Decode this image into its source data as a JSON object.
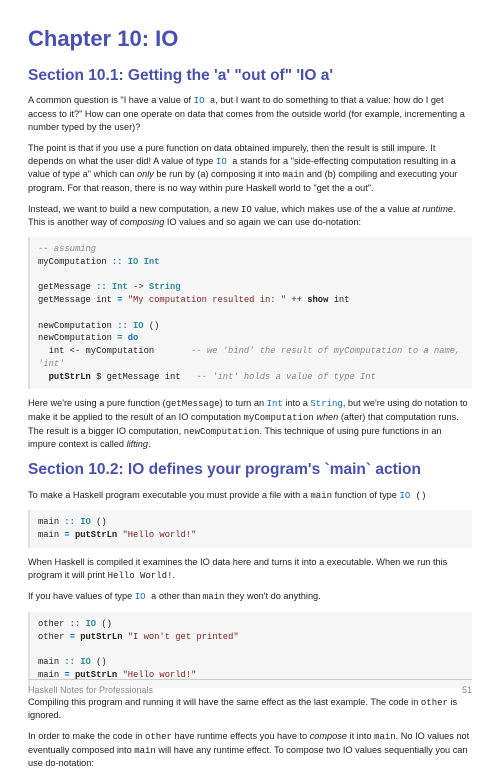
{
  "chapter": {
    "title": "Chapter 10: IO"
  },
  "section1": {
    "title": "Section 10.1: Getting the 'a' \"out of\" 'IO a'",
    "p1_a": "A common question is \"I have a value of ",
    "p1_b": ", but I want to do something to that a value: how do I get access to it?\" How can one operate on data that comes from the outside world (for example, incrementing a number typed by the user)?",
    "p2_a": "The point is that if you use a pure function on data obtained impurely, then the result is still impure. It depends on what the user did! A value of type ",
    "p2_b": " stands for a \"side-effecting computation resulting in a value of type a\" which can ",
    "p2_only": "only",
    "p2_c": " be run by (a) composing it into ",
    "p2_main": "main",
    "p2_d": " and (b) compiling and executing your program. For that reason, there is no way within pure Haskell world to \"get the a out\".",
    "p3_a": "Instead, we want to build a new computation, a new ",
    "p3_io": "IO",
    "p3_b": " value, which makes use of the a value ",
    "p3_runtime": "at runtime",
    "p3_c": ". This is another way of ",
    "p3_composing": "composing",
    "p3_d": " IO values and so again we can use do-notation:",
    "p4_a": "Here we're using a pure function (",
    "p4_gm": "getMessage",
    "p4_b": ") to turn an ",
    "p4_int": "Int",
    "p4_c": " into a ",
    "p4_string": "String",
    "p4_d": ", but we're using do notation to make it be applied to the result of an IO computation ",
    "p4_mycomp": "myComputation",
    "p4_e": " ",
    "p4_when": "when",
    "p4_f": " (after) that computation runs. The result is a bigger IO computation, ",
    "p4_newcomp": "newComputation",
    "p4_g": ". This technique of using pure functions in an impure context is called ",
    "p4_lifting": "lifting",
    "p4_h": "."
  },
  "section2": {
    "title": "Section 10.2: IO defines your program's `main` action",
    "p1": "To make a Haskell program executable you must provide a file with a ",
    "p1_main": "main",
    "p1_b": " function of type ",
    "p2_a": "When Haskell is compiled it examines the IO data here and turns it into a executable. When we run this program it will print ",
    "p2_hw": "Hello World!",
    "p2_b": ".",
    "p3_a": "If you have values of type ",
    "p3_b": " other than ",
    "p3_main": "main",
    "p3_c": " they won't do anything.",
    "p4_a": "Compiling this program and running it will have the same effect as the last example. The code in ",
    "p4_other": "other",
    "p4_b": " is ignored.",
    "p5_a": "In order to make the code in ",
    "p5_other": "other",
    "p5_b": " have runtime effects you have to ",
    "p5_compose": "compose",
    "p5_c": " it into ",
    "p5_main": "main",
    "p5_d": ". No IO values not eventually composed into ",
    "p5_main2": "main",
    "p5_e": " will have any runtime effect. To compose two IO values sequentially you can use do-notation:"
  },
  "code1": {
    "l1": "-- assuming",
    "l2a": "myComputation ",
    "l2b": "::",
    "l2c": " IO Int",
    "l3a": "getMessage ",
    "l3b": "::",
    "l3c": " Int",
    "l3d": " -> ",
    "l3e": "String",
    "l4a": "getMessage int ",
    "l4b": "=",
    "l4c": " \"My computation resulted in: \"",
    "l4d": " ++ ",
    "l4e": "show",
    "l4f": " int",
    "l5a": "newComputation ",
    "l5b": "::",
    "l5c": " IO",
    "l5d": " ()",
    "l6a": "newComputation ",
    "l6b": "= do",
    "l7a": "  int <- myComputation       ",
    "l7b": "-- we 'bind' the result of myComputation to a name, 'int'",
    "l8a": "  putStrLn",
    "l8b": " $ getMessage int   ",
    "l8c": "-- 'int' holds a value of type Int"
  },
  "code2": {
    "l1a": "main ",
    "l1b": "::",
    "l1c": " IO",
    "l1d": " ()",
    "l2a": "main ",
    "l2b": "= ",
    "l2c": "putStrLn",
    "l2d": " \"Hello world!\""
  },
  "code3": {
    "l1a": "other ",
    "l1b": "::",
    "l1c": " IO",
    "l1d": " ()",
    "l2a": "other ",
    "l2b": "= ",
    "l2c": "putStrLn",
    "l2d": " \"I won't get printed\"",
    "l3a": "main ",
    "l3b": "::",
    "l3c": " IO",
    "l3d": " ()",
    "l4a": "main ",
    "l4b": "= ",
    "l4c": "putStrLn",
    "l4d": " \"Hello world!\""
  },
  "io_kw": "IO",
  "io_a": " a",
  "unit": " ()",
  "footer": {
    "left": "Haskell Notes for Professionals",
    "right": "51"
  }
}
